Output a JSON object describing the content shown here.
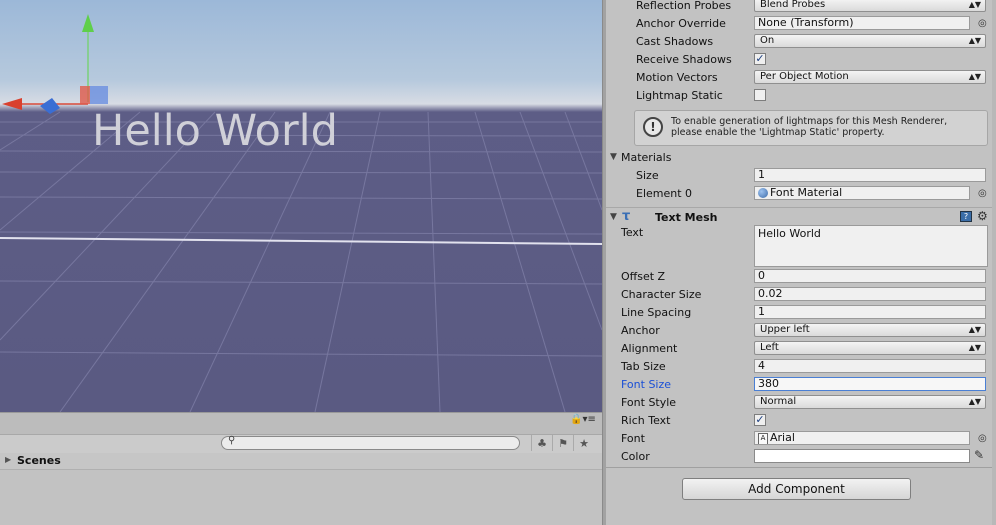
{
  "scene": {
    "text_mesh_preview": "Hello World"
  },
  "project": {
    "search": {
      "placeholder": "",
      "value": ""
    },
    "toolbar_icons": [
      "filter-by-type-icon",
      "filter-by-label-icon",
      "favorite-star-icon"
    ],
    "tree": [
      {
        "label": "Scenes"
      }
    ]
  },
  "inspector": {
    "mesh_renderer": {
      "reflection_probes": {
        "label": "Reflection Probes",
        "value": "Blend Probes"
      },
      "anchor_override": {
        "label": "Anchor Override",
        "value": "None (Transform)"
      },
      "cast_shadows": {
        "label": "Cast Shadows",
        "value": "On"
      },
      "receive_shadows": {
        "label": "Receive Shadows",
        "checked": true
      },
      "motion_vectors": {
        "label": "Motion Vectors",
        "value": "Per Object Motion"
      },
      "lightmap_static": {
        "label": "Lightmap Static",
        "checked": false
      },
      "help_box": {
        "line1": "To enable generation of lightmaps for this Mesh Renderer,",
        "line2": "please enable the 'Lightmap Static' property."
      },
      "materials": {
        "label": "Materials",
        "size": {
          "label": "Size",
          "value": "1"
        },
        "element0": {
          "label": "Element 0",
          "value": "Font Material"
        }
      }
    },
    "text_mesh": {
      "title": "Text Mesh",
      "text": {
        "label": "Text",
        "value": "Hello World"
      },
      "offset_z": {
        "label": "Offset Z",
        "value": "0"
      },
      "character_size": {
        "label": "Character Size",
        "value": "0.02"
      },
      "line_spacing": {
        "label": "Line Spacing",
        "value": "1"
      },
      "anchor": {
        "label": "Anchor",
        "value": "Upper left"
      },
      "alignment": {
        "label": "Alignment",
        "value": "Left"
      },
      "tab_size": {
        "label": "Tab Size",
        "value": "4"
      },
      "font_size": {
        "label": "Font Size",
        "value": "380"
      },
      "font_style": {
        "label": "Font Style",
        "value": "Normal"
      },
      "rich_text": {
        "label": "Rich Text",
        "checked": true
      },
      "font": {
        "label": "Font",
        "value": "Arial"
      },
      "color": {
        "label": "Color",
        "hex": "#ffffff"
      }
    },
    "add_component": "Add Component"
  },
  "colors": {
    "focused_label": "#1a4fd6",
    "panel_bg": "#c2c2c2",
    "ground": "#5a5a82"
  }
}
